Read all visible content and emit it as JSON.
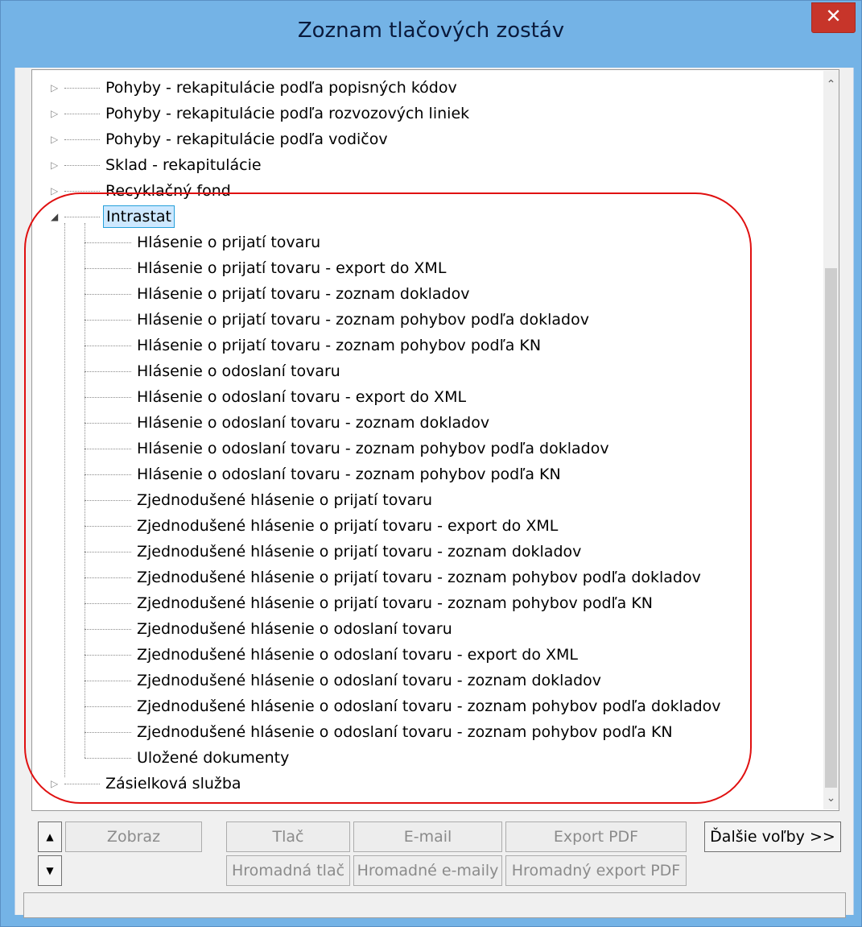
{
  "window": {
    "title": "Zoznam tlačových zostáv",
    "close_symbol": "✕",
    "accent_color": "#74b3e6",
    "close_color": "#c7352a"
  },
  "tree": {
    "top_items": [
      {
        "label": "Pohyby - rekapitulácie podľa popisných kódov",
        "expanded": false
      },
      {
        "label": "Pohyby - rekapitulácie podľa rozvozových liniek",
        "expanded": false
      },
      {
        "label": "Pohyby - rekapitulácie podľa vodičov",
        "expanded": false
      },
      {
        "label": "Sklad - rekapitulácie",
        "expanded": false
      },
      {
        "label": "Recyklačný fond",
        "expanded": false
      }
    ],
    "selected_item": {
      "label": "Intrastat",
      "expanded": true
    },
    "children": [
      "Hlásenie o prijatí tovaru",
      "Hlásenie o prijatí tovaru - export do XML",
      "Hlásenie o prijatí tovaru - zoznam dokladov",
      "Hlásenie o prijatí tovaru - zoznam pohybov podľa dokladov",
      "Hlásenie o prijatí tovaru - zoznam pohybov podľa KN",
      "Hlásenie o odoslaní tovaru",
      "Hlásenie o odoslaní tovaru - export do XML",
      "Hlásenie o odoslaní tovaru - zoznam dokladov",
      "Hlásenie o odoslaní tovaru - zoznam pohybov podľa dokladov",
      "Hlásenie o odoslaní tovaru - zoznam pohybov podľa KN",
      "Zjednodušené hlásenie o prijatí tovaru",
      "Zjednodušené hlásenie o prijatí tovaru - export do XML",
      "Zjednodušené hlásenie o prijatí tovaru - zoznam dokladov",
      "Zjednodušené hlásenie o prijatí tovaru - zoznam pohybov podľa dokladov",
      "Zjednodušené hlásenie o prijatí tovaru - zoznam pohybov podľa KN",
      "Zjednodušené hlásenie o odoslaní tovaru",
      "Zjednodušené hlásenie o odoslaní tovaru - export do XML",
      "Zjednodušené hlásenie o odoslaní tovaru - zoznam dokladov",
      "Zjednodušené hlásenie o odoslaní tovaru - zoznam pohybov podľa dokladov",
      "Zjednodušené hlásenie o odoslaní tovaru - zoznam pohybov podľa KN",
      "Uložené dokumenty"
    ],
    "last_item": {
      "label": "Zásielková služba",
      "expanded": false
    },
    "collapsed_glyph": "▷",
    "expanded_glyph": "◢"
  },
  "scrollbar": {
    "up": "⌃",
    "down": "⌄"
  },
  "buttons": {
    "scroll_up": "▲",
    "scroll_down": "▼",
    "zobraz": "Zobraz",
    "tlac": "Tlač",
    "email": "E-mail",
    "export_pdf": "Export PDF",
    "dalsie_volby": "Ďalšie voľby >>",
    "hromadna_tlac": "Hromadná tlač",
    "hromadne_emaily": "Hromadné e-maily",
    "hromadny_export_pdf": "Hromadný export PDF"
  },
  "annotation_color": "#e01010"
}
